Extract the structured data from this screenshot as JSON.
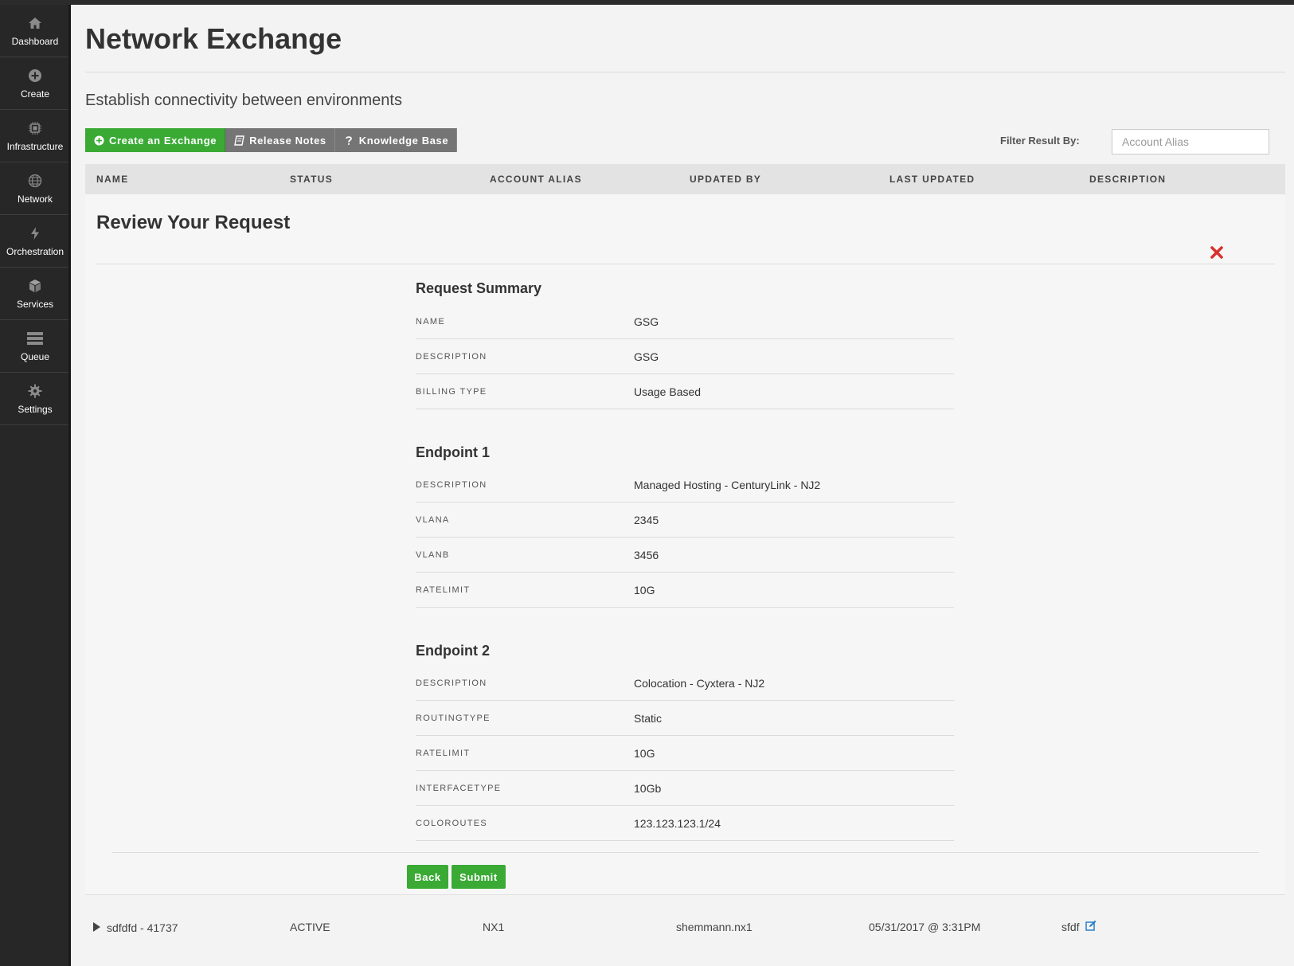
{
  "sidebar": {
    "items": [
      {
        "label": "Dashboard",
        "icon": "home-icon"
      },
      {
        "label": "Create",
        "icon": "plus-circle-icon"
      },
      {
        "label": "Infrastructure",
        "icon": "chip-icon"
      },
      {
        "label": "Network",
        "icon": "globe-icon"
      },
      {
        "label": "Orchestration",
        "icon": "bolt-icon"
      },
      {
        "label": "Services",
        "icon": "cube-icon"
      },
      {
        "label": "Queue",
        "icon": "server-stack-icon"
      },
      {
        "label": "Settings",
        "icon": "gear-icon"
      }
    ]
  },
  "header": {
    "title": "Network Exchange",
    "subtitle": "Establish connectivity between environments"
  },
  "toolbar": {
    "create_label": "Create an Exchange",
    "release_notes_label": "Release Notes",
    "knowledge_base_label": "Knowledge Base"
  },
  "filter": {
    "label": "Filter Result By:",
    "placeholder": "Account Alias"
  },
  "table": {
    "columns": [
      "NAME",
      "STATUS",
      "ACCOUNT ALIAS",
      "UPDATED BY",
      "LAST UPDATED",
      "DESCRIPTION"
    ],
    "row": {
      "name": "sdfdfd - 41737",
      "status": "ACTIVE",
      "account_alias": "NX1",
      "updated_by": "shemmann.nx1",
      "last_updated": "05/31/2017 @ 3:31PM",
      "description": "sfdf"
    }
  },
  "review": {
    "title": "Review Your Request",
    "summary": {
      "title": "Request Summary",
      "rows": [
        {
          "key": "NAME",
          "value": "GSG"
        },
        {
          "key": "DESCRIPTION",
          "value": "GSG"
        },
        {
          "key": "BILLING TYPE",
          "value": "Usage Based"
        }
      ]
    },
    "endpoint1": {
      "title": "Endpoint 1",
      "rows": [
        {
          "key": "DESCRIPTION",
          "value": "Managed Hosting - CenturyLink - NJ2"
        },
        {
          "key": "VLANA",
          "value": "2345"
        },
        {
          "key": "VLANB",
          "value": "3456"
        },
        {
          "key": "RATELIMIT",
          "value": "10G"
        }
      ]
    },
    "endpoint2": {
      "title": "Endpoint 2",
      "rows": [
        {
          "key": "DESCRIPTION",
          "value": "Colocation - Cyxtera - NJ2"
        },
        {
          "key": "ROUTINGTYPE",
          "value": "Static"
        },
        {
          "key": "RATELIMIT",
          "value": "10G"
        },
        {
          "key": "INTERFACETYPE",
          "value": "10Gb"
        },
        {
          "key": "COLOROUTES",
          "value": "123.123.123.1/24"
        }
      ]
    },
    "back_label": "Back",
    "submit_label": "Submit"
  },
  "colors": {
    "accent_green": "#3aaa35",
    "sidebar_bg": "#272727",
    "close_red": "#d9302c",
    "edit_blue": "#2a7fc9"
  }
}
